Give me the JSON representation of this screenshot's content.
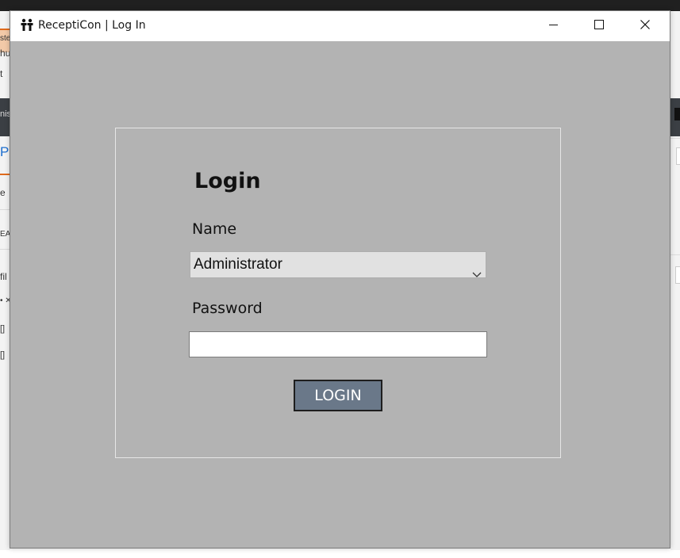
{
  "window": {
    "title": "ReceptiCon | Log In",
    "app_icon": "people-icon",
    "controls": {
      "minimize_icon": "minimize-icon",
      "maximize_icon": "maximize-icon",
      "close_icon": "close-icon"
    }
  },
  "login": {
    "heading": "Login",
    "name_label": "Name",
    "name_selected": "Administrator",
    "password_label": "Password",
    "password_value": "",
    "button_label": "LOGIN"
  },
  "background_app": {
    "fragments": [
      "ste",
      "hu",
      "t",
      "nis",
      "Pa",
      "e",
      "EA",
      "fil",
      "• ✕",
      "[]",
      "[]"
    ]
  },
  "colors": {
    "dialog_background": "#b3b3b3",
    "button_background": "#6a7889",
    "select_background": "#e1e1e1"
  }
}
